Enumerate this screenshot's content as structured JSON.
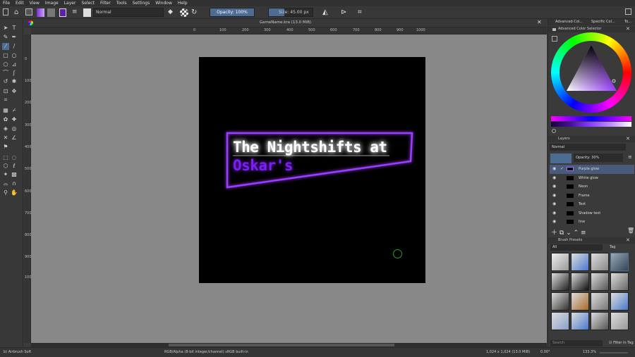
{
  "menu": [
    "File",
    "Edit",
    "View",
    "Image",
    "Layer",
    "Select",
    "Filter",
    "Tools",
    "Settings",
    "Window",
    "Help"
  ],
  "toolbar": {
    "blend_mode": "Normal",
    "opacity_label": "Opacity: 100%",
    "size_label": "Size: 45.00 px"
  },
  "document_tab": "GameName.kra (13.0 MiB)",
  "ruler_h": [
    "0",
    "100",
    "200",
    "300",
    "400",
    "500",
    "600",
    "700",
    "800",
    "900",
    "1000"
  ],
  "ruler_v": [
    "0",
    "100",
    "200",
    "300",
    "400",
    "500",
    "600",
    "700",
    "800",
    "900",
    "1000"
  ],
  "artwork": {
    "line1": "The Nightshifts at",
    "line2": "Oskar's"
  },
  "dock": {
    "tabs": [
      "Advanced Col...",
      "Specific Col...",
      "To..."
    ],
    "color_selector_title": "Advanced Color Selector",
    "layers_title": "Layers",
    "layers_blend": "Normal",
    "layers_opacity": "Opacity:  30%",
    "layers": [
      "Purple glow",
      "White glow",
      "Neon",
      "Frame",
      "Text",
      "Shadow text",
      "line"
    ],
    "brush_presets_title": "Brush Presets",
    "brush_filter": "All",
    "brush_tag": "Tag",
    "search_placeholder": "Search",
    "filter_in_tag": "Filter in Tag"
  },
  "status": {
    "brush": "b) Airbrush Soft",
    "color_space": "RGB/Alpha (8-bit integer/channel)  sRGB built-in",
    "dims": "1,024 x 1,024 (13.0 MiB)",
    "rotation": "0.00°",
    "zoom": "133.3%"
  }
}
